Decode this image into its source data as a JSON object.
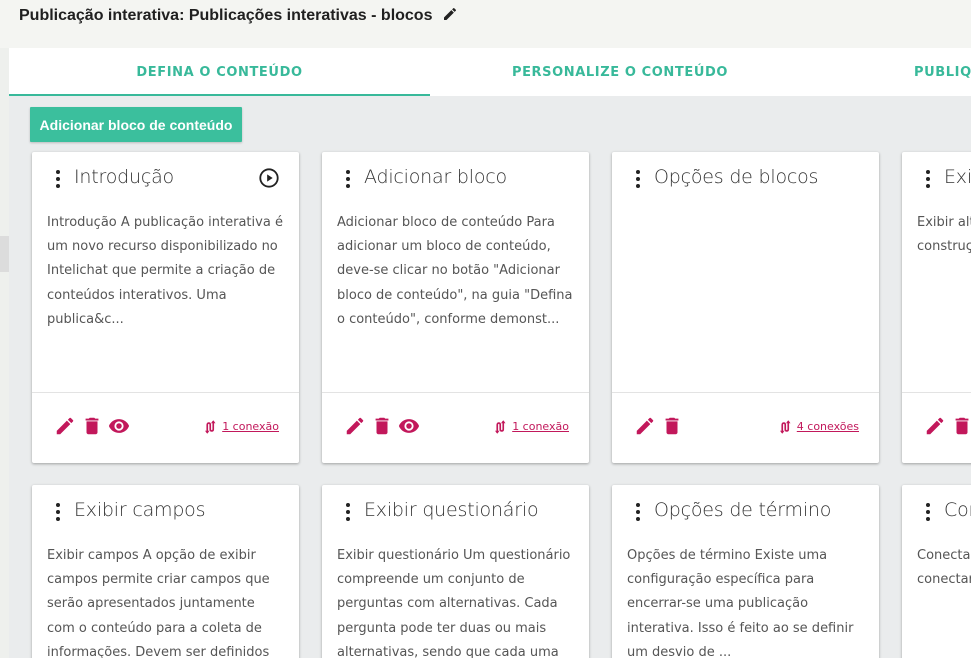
{
  "header": {
    "title": "Publicação interativa:  Publicações interativas - blocos"
  },
  "tabs": [
    {
      "label": "DEFINA O CONTEÚDO",
      "active": true
    },
    {
      "label": "PERSONALIZE O CONTEÚDO",
      "active": false
    },
    {
      "label": "PUBLIQU",
      "active": false
    }
  ],
  "toolbar": {
    "add_block_label": "Adicionar bloco de conteúdo"
  },
  "colors": {
    "accent": "#3bbf9d",
    "action": "#c2185b"
  },
  "icons": {
    "title_edit": "pencil-icon",
    "card_menu": "more-vert-icon",
    "play": "play-circle-icon",
    "edit": "pencil-icon",
    "delete": "trash-icon",
    "view": "eye-icon",
    "connections": "connection-arrows-icon"
  },
  "cards": [
    {
      "title": "Introdução",
      "has_play": true,
      "description": "Introdução A publicação interativa é um novo recurso disponibilizado no Intelichat que permite a criação de conteúdos interativos. Uma publica&c...",
      "actions": [
        "edit",
        "delete",
        "view"
      ],
      "connections": "1 conexão"
    },
    {
      "title": "Adicionar bloco",
      "has_play": false,
      "description": "Adicionar bloco de conteúdo Para adicionar um bloco de conteúdo, deve-se clicar no botão \"Adicionar bloco de conteúdo\", na guia \"Defina o conteúdo\", conforme demonst...",
      "actions": [
        "edit",
        "delete",
        "view"
      ],
      "connections": "1 conexão"
    },
    {
      "title": "Opções de blocos",
      "has_play": false,
      "description": "",
      "actions": [
        "edit",
        "delete"
      ],
      "connections": "4 conexões"
    },
    {
      "title": "Exib",
      "has_play": false,
      "description": "Exibir alte opção é dos leito construç que será forma de",
      "actions": [
        "edit",
        "delete"
      ],
      "connections": ""
    },
    {
      "title": "Exibir campos",
      "has_play": false,
      "description": "Exibir campos A opção de exibir campos permite criar campos que serão apresentados juntamente com o conteúdo para a coleta de informações. Devem ser definidos os",
      "actions": [],
      "connections": ""
    },
    {
      "title": "Exibir questionário",
      "has_play": false,
      "description": "Exibir questionário Um questionário compreende um conjunto de perguntas com alternativas. Cada pergunta pode ter duas ou mais alternativas, sendo que cada uma",
      "actions": [],
      "connections": ""
    },
    {
      "title": "Opções de término",
      "has_play": false,
      "description": "Opções de término Existe uma configuração específica para encerrar-se uma publicação interativa. Isso é feito ao se definir um desvio de ...",
      "actions": [],
      "connections": ""
    },
    {
      "title": "Cor",
      "has_play": false,
      "description": "Conectar que você blocos de conectar forma m",
      "actions": [],
      "connections": ""
    }
  ]
}
